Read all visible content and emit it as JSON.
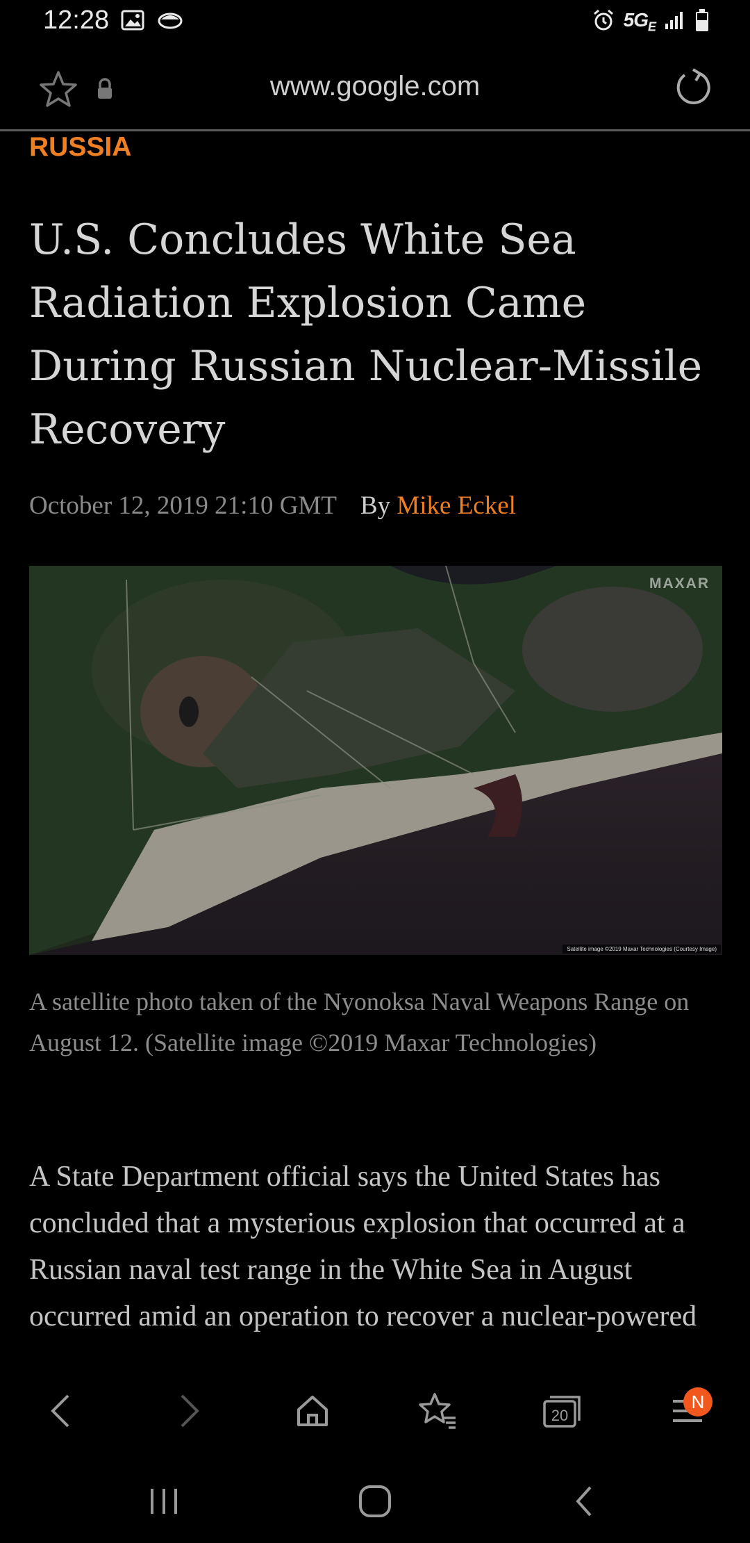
{
  "status": {
    "time": "12:28",
    "network": "5G",
    "network_sub": "E",
    "icons": [
      "image-icon",
      "cloud-icon",
      "alarm-icon",
      "signal-icon",
      "battery-icon"
    ]
  },
  "browser": {
    "url": "www.google.com",
    "tab_count": "20",
    "notification_badge": "N"
  },
  "article": {
    "section": "RUSSIA",
    "headline_lines": [
      "U.S. Concludes White Sea",
      "Radiation Explosion Came",
      "During Russian Nuclear-Missile",
      "Recovery"
    ],
    "date": "October 12, 2019 21:10 GMT",
    "by_label": "By",
    "author": "Mike Eckel",
    "photo_watermark": "MAXAR",
    "photo_credit": "Satellite image ©2019 Maxar Technologies (Courtesy Image)",
    "caption": "A satellite photo taken of the Nyonoksa Naval Weapons Range on August 12. (Satellite image ©2019 Maxar Technologies)",
    "body": "A State Department official says the United States has concluded that a mysterious explosion that occurred at a Russian naval test range in the White Sea in August occurred amid an operation to recover a nuclear-powered"
  },
  "colors": {
    "accent": "#f07f22",
    "background": "#000000",
    "badge": "#f2581e"
  }
}
